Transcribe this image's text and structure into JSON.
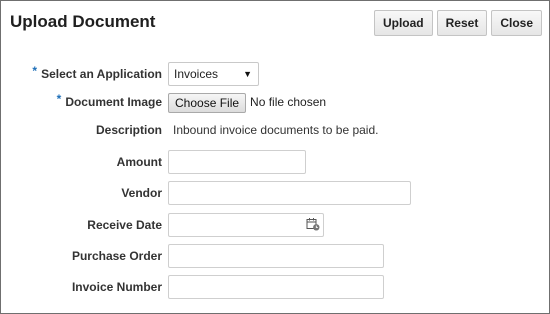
{
  "header": {
    "title": "Upload Document",
    "buttons": {
      "upload": "Upload",
      "reset": "Reset",
      "close": "Close"
    }
  },
  "form": {
    "application": {
      "label": "Select an Application",
      "required": "*",
      "value": "Invoices"
    },
    "document_image": {
      "label": "Document Image",
      "required": "*",
      "button": "Choose File",
      "status": "No file chosen"
    },
    "description": {
      "label": "Description",
      "value": "Inbound invoice documents to be paid."
    },
    "amount": {
      "label": "Amount",
      "value": ""
    },
    "vendor": {
      "label": "Vendor",
      "value": ""
    },
    "receive_date": {
      "label": "Receive Date",
      "value": "",
      "icon": "calendar-icon"
    },
    "purchase_order": {
      "label": "Purchase Order",
      "value": ""
    },
    "invoice_number": {
      "label": "Invoice Number",
      "value": ""
    }
  },
  "colors": {
    "required_marker": "#1e6fb8",
    "border": "#6f6f6f"
  }
}
